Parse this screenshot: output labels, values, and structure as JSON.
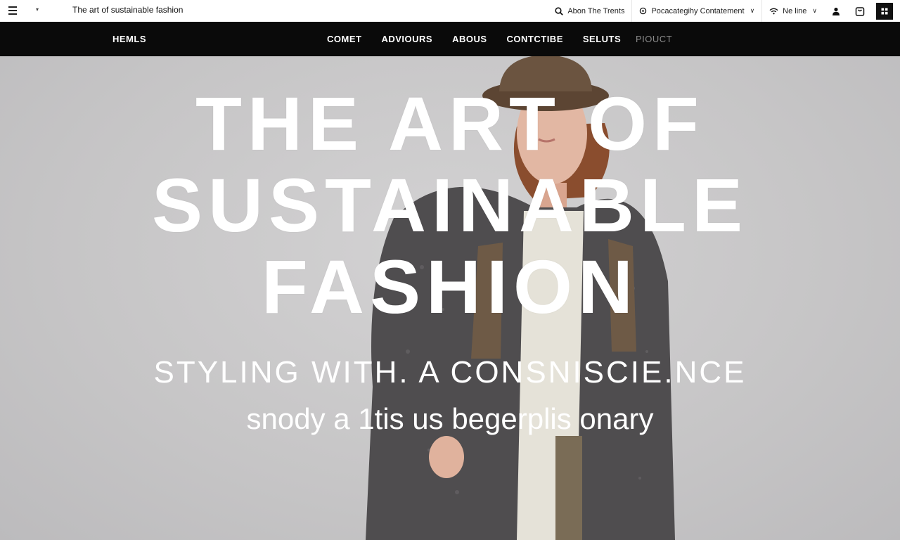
{
  "topbar": {
    "site_title": "The art of sustainable fashion",
    "menu_icon": "menu-icon",
    "search_label": "Abon The Trents",
    "category_label": "Pocacategihy Contatement",
    "network_label": "Ne line",
    "user_icon": "user-icon",
    "bag_icon": "bag-icon",
    "grid_icon": "grid-icon"
  },
  "navbar": {
    "brand": "HEMLS",
    "links": [
      "COMET",
      "ADVIOURS",
      "ABOUS",
      "CONTCTIBE",
      "SELUTS"
    ],
    "muted_link": "PIOUCT"
  },
  "hero": {
    "headline_lines": [
      "THE ART OF",
      "SUSTAINABLE",
      "FASHION"
    ],
    "subline": "STYLING WITH. A CONSNISCIE.NCE",
    "tagline": "snody a 1tis us begerplis onary"
  },
  "colors": {
    "navbar_bg": "#0a0a0a",
    "hero_bg": "#c9c8c9",
    "coat": "#4f4d4f",
    "hat": "#6b5440"
  }
}
